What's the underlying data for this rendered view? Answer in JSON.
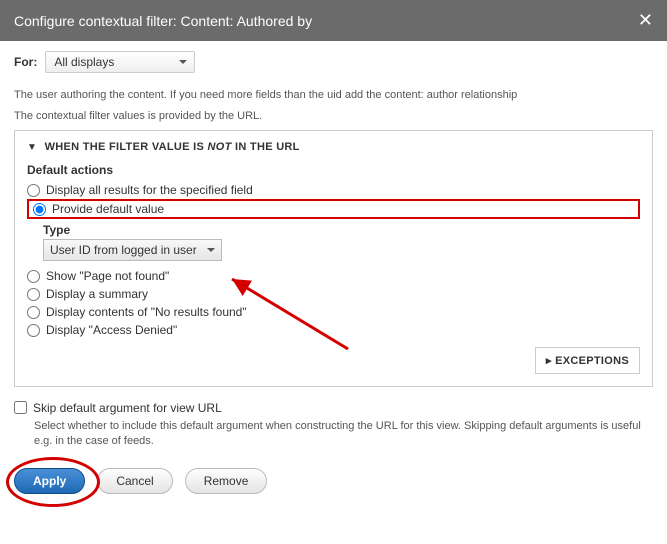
{
  "header": {
    "title": "Configure contextual filter: Content: Authored by"
  },
  "for": {
    "label": "For:",
    "value": "All displays"
  },
  "help_line1": "The user authoring the content. If you need more fields than the uid add the content: author relationship",
  "help_line2": "The contextual filter values is provided by the URL.",
  "fs_legend_prefix": "WHEN THE FILTER VALUE IS ",
  "fs_legend_not": "NOT",
  "fs_legend_suffix": " IN THE URL",
  "default_actions_title": "Default actions",
  "opts": {
    "all": "Display all results for the specified field",
    "provide": "Provide default value",
    "notfound": "Show \"Page not found\"",
    "summary": "Display a summary",
    "noresults": "Display contents of \"No results found\"",
    "denied": "Display \"Access Denied\""
  },
  "type_label": "Type",
  "type_value": "User ID from logged in user",
  "exceptions_label": "EXCEPTIONS",
  "skip": {
    "label": "Skip default argument for view URL",
    "help": "Select whether to include this default argument when constructing the URL for this view. Skipping default arguments is useful e.g. in the case of feeds."
  },
  "buttons": {
    "apply": "Apply",
    "cancel": "Cancel",
    "remove": "Remove"
  }
}
